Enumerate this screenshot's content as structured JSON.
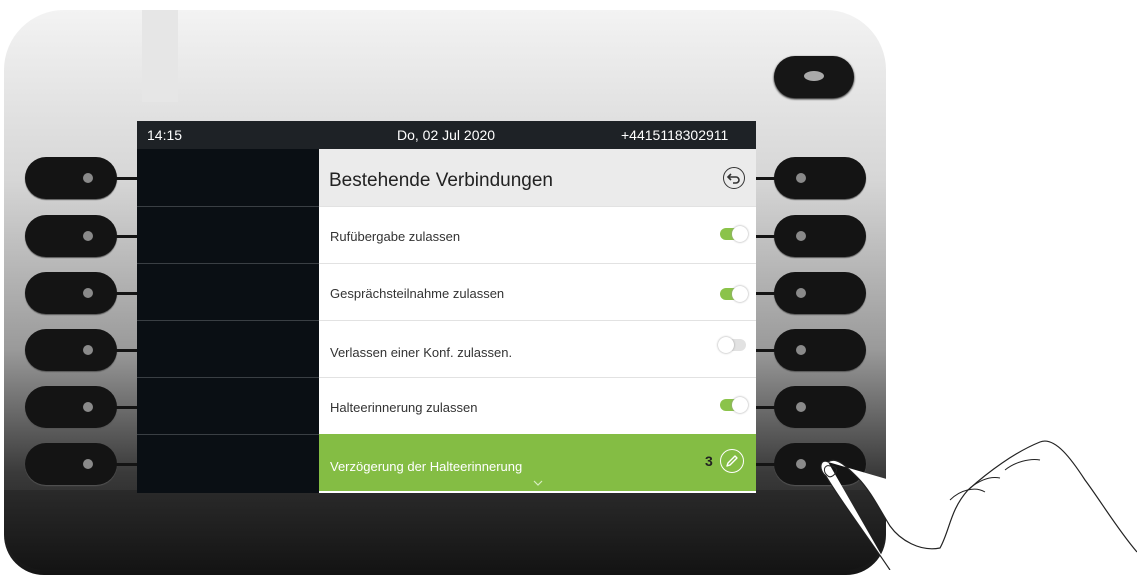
{
  "status_bar": {
    "time": "14:15",
    "date": "Do, 02 Jul 2020",
    "number": "+4415118302911"
  },
  "menu": {
    "title": "Bestehende Verbindungen",
    "back_icon": "back-arrow-icon",
    "items": [
      {
        "label": "Rufübergabe zulassen",
        "toggle": true
      },
      {
        "label": "Gesprächsteilnahme zulassen",
        "toggle": true
      },
      {
        "label": "Verlassen einer Konf. zulassen.",
        "toggle": false
      },
      {
        "label": "Halteerinnerung zulassen",
        "toggle": true
      },
      {
        "label": "Verzögerung der Halteerinnerung",
        "value": "3",
        "edit_icon": "pencil-icon",
        "selected": true
      }
    ]
  },
  "colors": {
    "accent_green": "#84bd44",
    "toggle_on": "#8bc34a",
    "screen_bg": "#0a0f14"
  }
}
